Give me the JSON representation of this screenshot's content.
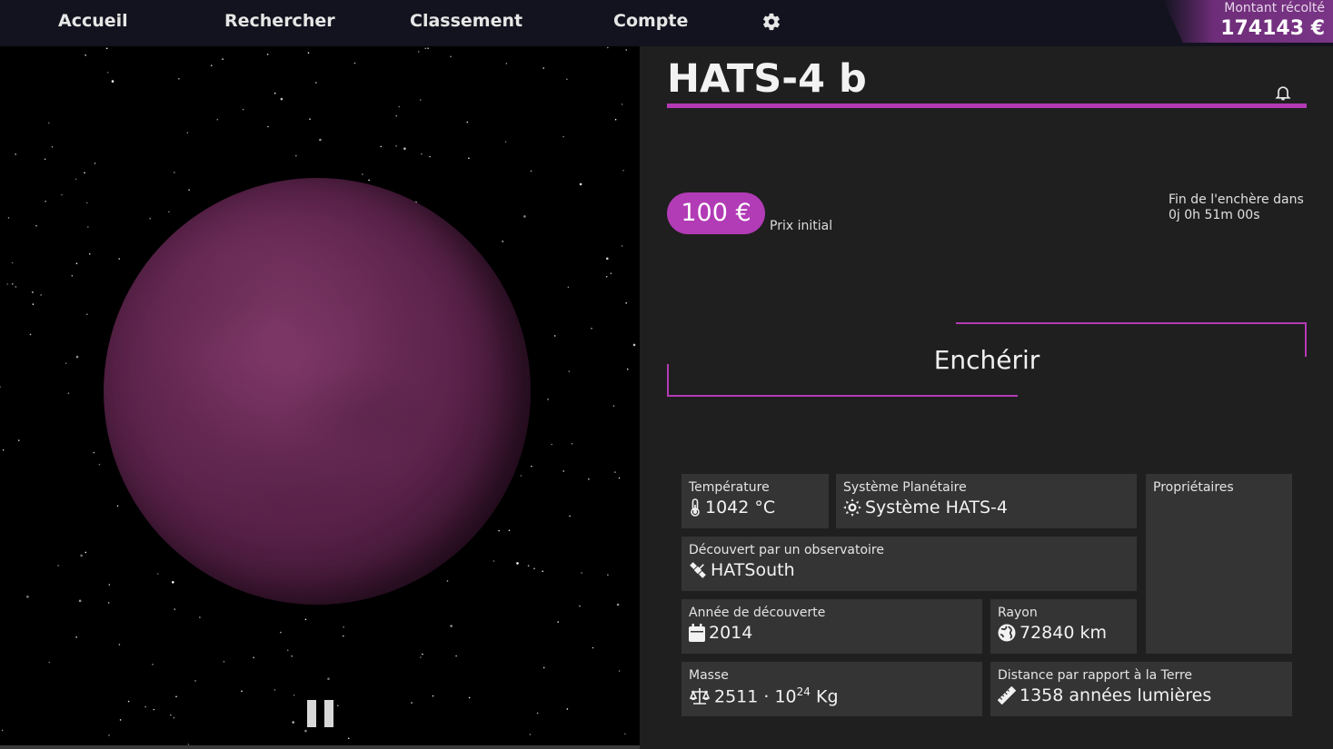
{
  "nav": {
    "items": [
      "Accueil",
      "Rechercher",
      "Classement",
      "Compte"
    ],
    "settings_icon": "gear-icon"
  },
  "fund": {
    "label": "Montant récolté",
    "value": "174143 €"
  },
  "planet": {
    "name": "HATS-4 b",
    "initial_price": "100 €",
    "initial_price_label": "Prix initial",
    "auction_end_label": "Fin de l'enchère dans",
    "auction_end_value": "0j 0h 51m 00s",
    "bid_label": "Enchérir",
    "planet_color": "#5a2249",
    "accent_color": "#b43ab5"
  },
  "details": {
    "temperature": {
      "label": "Température",
      "value": "1042 °C",
      "icon": "thermometer-icon"
    },
    "system": {
      "label": "Système Planétaire",
      "value": "Système HATS-4",
      "icon": "sun-icon"
    },
    "owners": {
      "label": "Propriétaires"
    },
    "observatory": {
      "label": "Découvert par un observatoire",
      "value": "HATSouth",
      "icon": "satellite-icon"
    },
    "year": {
      "label": "Année de découverte",
      "value": "2014",
      "icon": "calendar-icon"
    },
    "radius": {
      "label": "Rayon",
      "value": "72840 km",
      "icon": "globe-icon"
    },
    "mass": {
      "label": "Masse",
      "base": "2511 · 10",
      "exponent": "24",
      "unit": "Kg",
      "icon": "scale-icon"
    },
    "distance": {
      "label": "Distance par rapport à la Terre",
      "value": "1358 années lumières",
      "icon": "ruler-icon"
    }
  },
  "controls": {
    "pause_icon": "pause-icon"
  }
}
